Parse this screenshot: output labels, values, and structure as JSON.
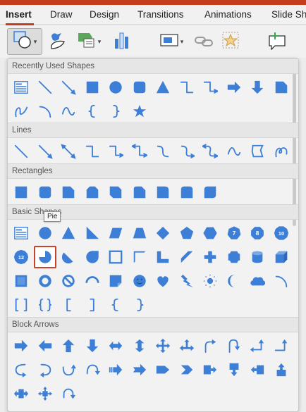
{
  "tabs": [
    "Insert",
    "Draw",
    "Design",
    "Transitions",
    "Animations",
    "Slide Sh"
  ],
  "ribbon": [
    {
      "name": "shapes-button",
      "icon": "shapes",
      "caret": true,
      "selected": true
    },
    {
      "name": "icons-button",
      "icon": "icons",
      "caret": false
    },
    {
      "name": "smartart-button",
      "icon": "smartart",
      "caret": true
    },
    {
      "name": "chart-button",
      "icon": "chart",
      "caret": false
    },
    {
      "name": "screenshot-button",
      "icon": "screenshot",
      "caret": true
    },
    {
      "name": "link-button",
      "icon": "link",
      "caret": false
    },
    {
      "name": "action-button",
      "icon": "action",
      "caret": false
    },
    {
      "name": "new-comment-button",
      "icon": "comment",
      "caret": false
    }
  ],
  "sections": [
    {
      "title": "Recently Used Shapes",
      "rows": [
        [
          "textbox",
          "line",
          "arrowline",
          "rect",
          "oval",
          "roundrect",
          "triangle",
          "elbow",
          "elbowarrow",
          "rightarrow",
          "downarrow",
          "snip1"
        ],
        [
          "freeform",
          "arc",
          "curve",
          "lbrace",
          "rbrace",
          "star5"
        ]
      ]
    },
    {
      "title": "Lines",
      "rows": [
        [
          "line",
          "arrowline",
          "dblarrowline",
          "elbow",
          "elbowarrow",
          "elbowdblarrow",
          "curvedconn",
          "curvedconnarrow",
          "curvedconndbl",
          "curve",
          "freeform-poly",
          "scribble"
        ]
      ]
    },
    {
      "title": "Rectangles",
      "rows": [
        [
          "rect",
          "roundrect",
          "snip1",
          "snip2same",
          "snip2diag",
          "sniproundrect",
          "round1",
          "round2same",
          "round2diag"
        ]
      ]
    },
    {
      "title": "Basic Shapes",
      "rows": [
        [
          "textbox",
          "oval",
          "triangle",
          "rttriangle",
          "parallelogram",
          "trapezoid",
          "diamond",
          "pentagon",
          "hexagon",
          "octagon-7",
          "octagon-8",
          "decagon-10"
        ],
        [
          "dodecagon-12",
          "pie",
          "chord",
          "teardrop",
          "frame",
          "halfframe",
          "lshape",
          "diagstripe",
          "plus",
          "plaque",
          "can",
          "cube"
        ],
        [
          "bevel",
          "donut",
          "nosmoking",
          "blockarc",
          "foldedcorner",
          "smiley",
          "heart",
          "lightning",
          "sun",
          "moon",
          "cloud",
          "arc"
        ],
        [
          "bracketpair",
          "bracepair",
          "lbracket",
          "rbracket",
          "lbrace",
          "rbrace"
        ]
      ]
    },
    {
      "title": "Block Arrows",
      "rows": [
        [
          "rightarrow",
          "leftarrow",
          "uparrow",
          "downarrow",
          "leftright",
          "updown",
          "quadarrow",
          "leftrightup",
          "bentarrow",
          "uturn",
          "leftuparrow",
          "bentuparrow"
        ],
        [
          "curvedright",
          "curvedleft",
          "curvedup",
          "curveddown",
          "stripedright",
          "notchedright",
          "pentagonarrow",
          "chevron",
          "rightcallout",
          "downcallout",
          "leftcallout",
          "upcallout"
        ],
        [
          "leftrightcallout",
          "quadcallout",
          "circulararrow"
        ]
      ]
    }
  ],
  "highlight": {
    "section": 3,
    "row": 1,
    "col": 1
  },
  "tooltip": "Pie",
  "colors": {
    "accent": "#c43e1c",
    "shape": "#3d7fd6"
  }
}
